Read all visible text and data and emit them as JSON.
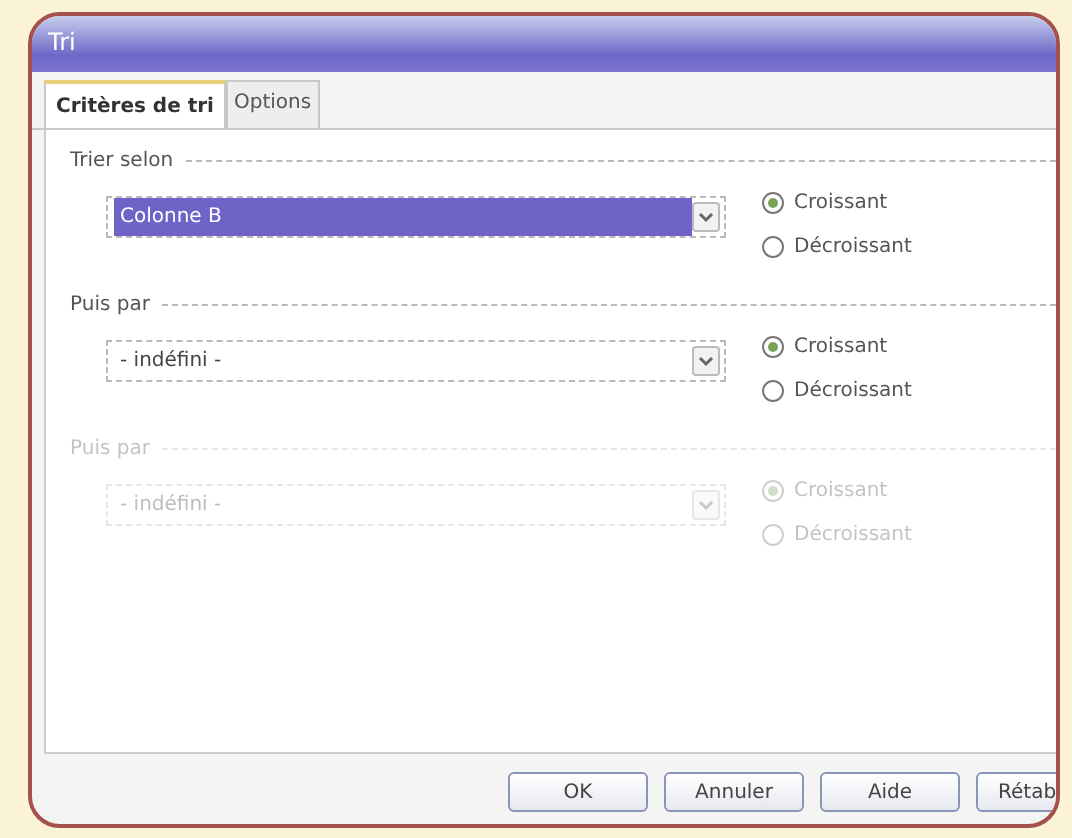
{
  "window": {
    "title": "Tri"
  },
  "tabs": [
    {
      "label": "Critères de tri",
      "selected": true
    },
    {
      "label": "Options",
      "selected": false
    }
  ],
  "sort_keys": [
    {
      "label": "Trier selon",
      "value": "Colonne B",
      "highlighted": true,
      "disabled": false,
      "options": [
        {
          "label": "Croissant",
          "selected": true
        },
        {
          "label": "Décroissant",
          "selected": false
        }
      ]
    },
    {
      "label": "Puis par",
      "value": "- indéfini -",
      "highlighted": false,
      "disabled": false,
      "options": [
        {
          "label": "Croissant",
          "selected": true
        },
        {
          "label": "Décroissant",
          "selected": false
        }
      ]
    },
    {
      "label": "Puis par",
      "value": "- indéfini -",
      "highlighted": false,
      "disabled": true,
      "options": [
        {
          "label": "Croissant",
          "selected": true
        },
        {
          "label": "Décroissant",
          "selected": false
        }
      ]
    }
  ],
  "buttons": [
    "OK",
    "Annuler",
    "Aide",
    "Rétab"
  ]
}
